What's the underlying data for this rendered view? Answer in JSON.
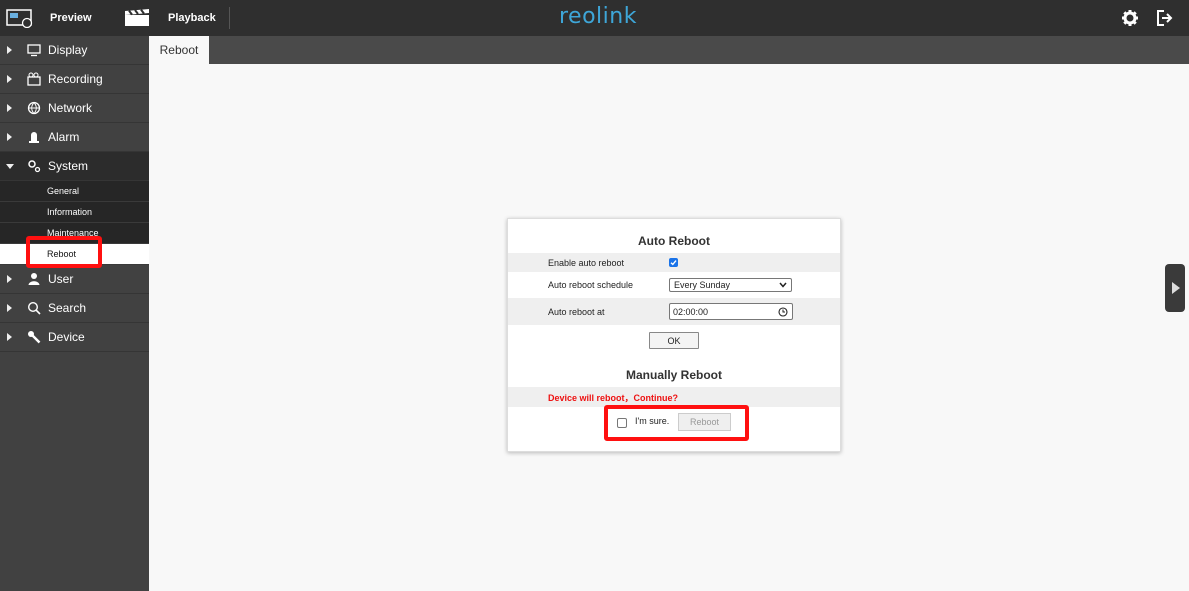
{
  "topbar": {
    "preview_label": "Preview",
    "playback_label": "Playback",
    "logo_text": "reolink"
  },
  "sidebar": {
    "items": [
      {
        "label": "Display",
        "icon": "monitor-icon"
      },
      {
        "label": "Recording",
        "icon": "recording-icon"
      },
      {
        "label": "Network",
        "icon": "network-icon"
      },
      {
        "label": "Alarm",
        "icon": "alarm-icon"
      },
      {
        "label": "System",
        "icon": "system-icon"
      },
      {
        "label": "User",
        "icon": "user-icon"
      },
      {
        "label": "Search",
        "icon": "search-icon"
      },
      {
        "label": "Device",
        "icon": "wrench-icon"
      }
    ],
    "system_sub": [
      {
        "label": "General"
      },
      {
        "label": "Information"
      },
      {
        "label": "Maintenance"
      },
      {
        "label": "Reboot"
      }
    ]
  },
  "tab": {
    "label": "Reboot"
  },
  "auto_reboot": {
    "title": "Auto Reboot",
    "enable_label": "Enable auto reboot",
    "enabled": true,
    "schedule_label": "Auto reboot schedule",
    "schedule_value": "Every Sunday",
    "time_label": "Auto reboot at",
    "time_value": "02:00:00",
    "ok_label": "OK"
  },
  "manual_reboot": {
    "title": "Manually Reboot",
    "warning": "Device will reboot，Continue?",
    "sure_label": "I'm sure.",
    "sure_checked": false,
    "reboot_label": "Reboot"
  },
  "colors": {
    "accent": "#3ea6d8",
    "highlight": "#ff1010",
    "warning": "#e11111"
  }
}
